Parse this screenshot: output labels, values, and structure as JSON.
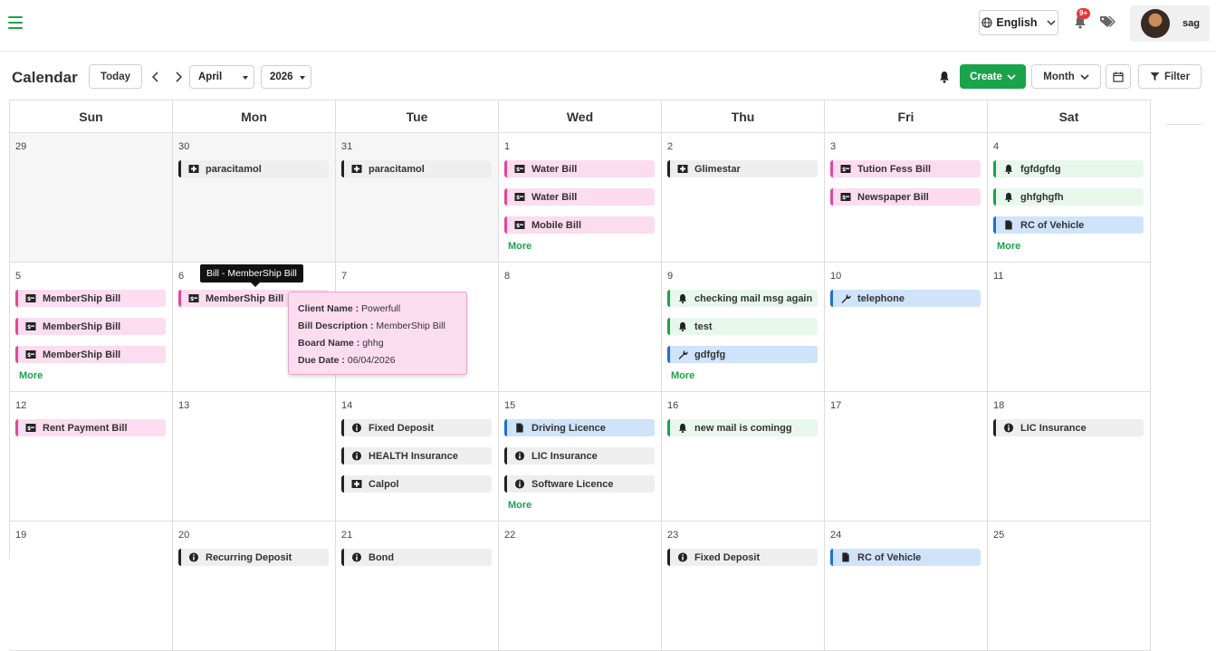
{
  "header": {
    "language": "English",
    "notification_badge": "9+",
    "user_name": "sag"
  },
  "toolbar": {
    "title": "Calendar",
    "today_label": "Today",
    "month_select": "April",
    "year_select": "2026",
    "create_label": "Create",
    "view_label": "Month",
    "filter_label": "Filter"
  },
  "weekdays": [
    "Sun",
    "Mon",
    "Tue",
    "Wed",
    "Thu",
    "Fri",
    "Sat"
  ],
  "weeks": [
    [
      "29",
      "30",
      "31",
      "1",
      "2",
      "3",
      "4"
    ],
    [
      "5",
      "6",
      "7",
      "8",
      "9",
      "10",
      "11"
    ],
    [
      "12",
      "13",
      "14",
      "15",
      "16",
      "17",
      "18"
    ],
    [
      "19",
      "20",
      "21",
      "22",
      "23",
      "24",
      "25"
    ]
  ],
  "more_label": "More",
  "events": [
    {
      "week": 0,
      "day": 1,
      "slot": 0,
      "title": "paracitamol",
      "color": "gray",
      "icon": "medicine-icon"
    },
    {
      "week": 0,
      "day": 2,
      "slot": 0,
      "title": "paracitamol",
      "color": "gray",
      "icon": "medicine-icon"
    },
    {
      "week": 0,
      "day": 3,
      "slot": 0,
      "title": "Water Bill",
      "color": "pink",
      "icon": "bill-icon"
    },
    {
      "week": 0,
      "day": 3,
      "slot": 1,
      "title": "Water Bill",
      "color": "pink",
      "icon": "bill-icon"
    },
    {
      "week": 0,
      "day": 3,
      "slot": 2,
      "title": "Mobile Bill",
      "color": "pink",
      "icon": "bill-icon"
    },
    {
      "week": 0,
      "day": 4,
      "slot": 0,
      "title": "Glimestar",
      "color": "gray",
      "icon": "medicine-icon"
    },
    {
      "week": 0,
      "day": 5,
      "slot": 0,
      "title": "Tution Fess Bill",
      "color": "pink",
      "icon": "bill-icon"
    },
    {
      "week": 0,
      "day": 5,
      "slot": 1,
      "title": "Newspaper Bill",
      "color": "pink",
      "icon": "bill-icon"
    },
    {
      "week": 0,
      "day": 6,
      "slot": 0,
      "title": "fgfdgfdg",
      "color": "green",
      "icon": "bell-icon"
    },
    {
      "week": 0,
      "day": 6,
      "slot": 1,
      "title": "ghfghgfh",
      "color": "green",
      "icon": "bell-icon"
    },
    {
      "week": 0,
      "day": 6,
      "slot": 2,
      "title": "RC of Vehicle",
      "color": "blue",
      "icon": "document-icon"
    },
    {
      "week": 1,
      "day": 0,
      "slot": 0,
      "title": "MemberShip Bill",
      "color": "pink",
      "icon": "bill-icon"
    },
    {
      "week": 1,
      "day": 0,
      "slot": 1,
      "title": "MemberShip Bill",
      "color": "pink",
      "icon": "bill-icon"
    },
    {
      "week": 1,
      "day": 0,
      "slot": 2,
      "title": "MemberShip Bill",
      "color": "pink",
      "icon": "bill-icon"
    },
    {
      "week": 1,
      "day": 1,
      "slot": 0,
      "title": "MemberShip Bill",
      "color": "pink",
      "icon": "bill-icon"
    },
    {
      "week": 1,
      "day": 4,
      "slot": 0,
      "title": "checking mail msg again",
      "color": "green",
      "icon": "bell-icon"
    },
    {
      "week": 1,
      "day": 4,
      "slot": 1,
      "title": "test",
      "color": "green",
      "icon": "bell-icon"
    },
    {
      "week": 1,
      "day": 4,
      "slot": 2,
      "title": "gdfgfg",
      "color": "blue",
      "icon": "wrench-icon"
    },
    {
      "week": 1,
      "day": 5,
      "slot": 0,
      "title": "telephone",
      "color": "blue",
      "icon": "wrench-icon"
    },
    {
      "week": 2,
      "day": 0,
      "slot": 0,
      "title": "Rent Payment Bill",
      "color": "pink",
      "icon": "bill-icon"
    },
    {
      "week": 2,
      "day": 2,
      "slot": 0,
      "title": "Fixed Deposit",
      "color": "gray",
      "icon": "info-icon"
    },
    {
      "week": 2,
      "day": 2,
      "slot": 1,
      "title": "HEALTH Insurance",
      "color": "gray",
      "icon": "info-icon"
    },
    {
      "week": 2,
      "day": 2,
      "slot": 2,
      "title": "Calpol",
      "color": "gray",
      "icon": "medicine-icon"
    },
    {
      "week": 2,
      "day": 3,
      "slot": 0,
      "title": "Driving Licence",
      "color": "blue",
      "icon": "document-icon"
    },
    {
      "week": 2,
      "day": 3,
      "slot": 1,
      "title": "LIC Insurance",
      "color": "gray",
      "icon": "info-icon"
    },
    {
      "week": 2,
      "day": 3,
      "slot": 2,
      "title": "Software Licence",
      "color": "gray",
      "icon": "info-icon"
    },
    {
      "week": 2,
      "day": 4,
      "slot": 0,
      "title": "new mail is comingg",
      "color": "green",
      "icon": "bell-icon"
    },
    {
      "week": 2,
      "day": 6,
      "slot": 0,
      "title": "LIC Insurance",
      "color": "gray",
      "icon": "info-icon"
    },
    {
      "week": 3,
      "day": 1,
      "slot": 0,
      "title": "Recurring Deposit",
      "color": "gray",
      "icon": "info-icon"
    },
    {
      "week": 3,
      "day": 2,
      "slot": 0,
      "title": "Bond",
      "color": "gray",
      "icon": "info-icon"
    },
    {
      "week": 3,
      "day": 4,
      "slot": 0,
      "title": "Fixed Deposit",
      "color": "gray",
      "icon": "info-icon"
    },
    {
      "week": 3,
      "day": 5,
      "slot": 0,
      "title": "RC of Vehicle",
      "color": "blue",
      "icon": "document-icon"
    }
  ],
  "more_links": [
    {
      "week": 0,
      "day": 3
    },
    {
      "week": 0,
      "day": 6
    },
    {
      "week": 1,
      "day": 0
    },
    {
      "week": 1,
      "day": 4
    },
    {
      "week": 2,
      "day": 3
    }
  ],
  "tooltip": {
    "title": "Bill - MemberShip Bill",
    "client_label": "Client Name :",
    "client_value": "Powerfull",
    "desc_label": "Bill Description :",
    "desc_value": "MemberShip Bill",
    "board_label": "Board Name :",
    "board_value": "ghhg",
    "due_label": "Due Date :",
    "due_value": "06/04/2026"
  }
}
